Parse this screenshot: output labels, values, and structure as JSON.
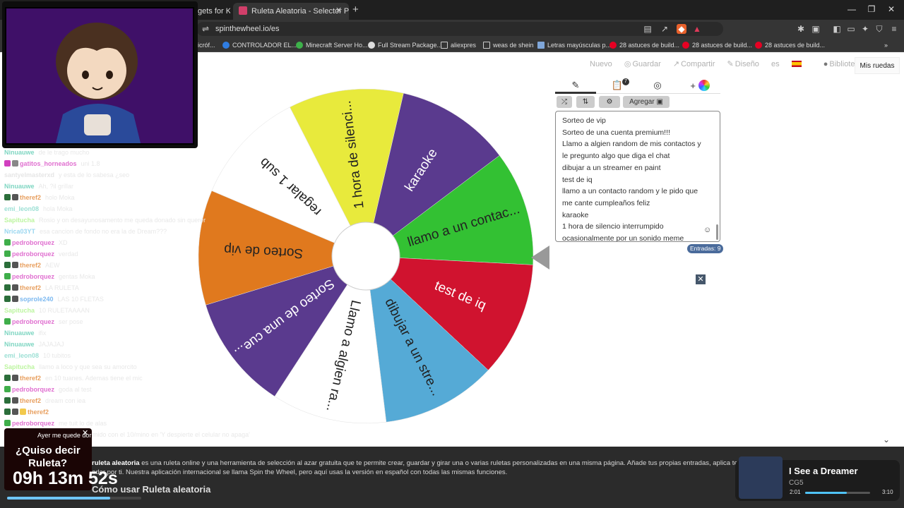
{
  "browser": {
    "tabs": [
      {
        "title": "gets for Ki"
      },
      {
        "title": "Ruleta Aleatoria - Selector Perso",
        "active": true
      }
    ],
    "url": "spinthewheel.io/es",
    "bookmarks": [
      "icróf...",
      "CONTROLADOR EL...",
      "Minecraft Server Ho...",
      "Full Stream Package...",
      "aliexpres",
      "weas de shein",
      "Letras mayúsculas p...",
      "28 astuces de build...",
      "28 astuces de build...",
      "28 astuces de build..."
    ]
  },
  "nav": {
    "nuevo": "Nuevo",
    "guardar": "Guardar",
    "compartir": "Compartir",
    "diseno": "Diseño",
    "lang": "es",
    "biblioteca": "Biblioteca",
    "mis_ruedas": "Mis ruedas"
  },
  "wheel": {
    "segments": [
      {
        "label": "karaoke",
        "color": "#5a3a8e",
        "text_color": "#ffffff"
      },
      {
        "label": "llamo a un contac...",
        "color": "#33c133",
        "text_color": "#222222"
      },
      {
        "label": "test de iq",
        "color": "#d0132f",
        "text_color": "#ffffff"
      },
      {
        "label": "dibujar a un stre...",
        "color": "#55aad6",
        "text_color": "#222222"
      },
      {
        "label": "Llamo a algien ra...",
        "color": "#ffffff",
        "text_color": "#222222"
      },
      {
        "label": "Sorteo de una cue...",
        "color": "#5a3a8e",
        "text_color": "#ffffff"
      },
      {
        "label": "Sorteo de vip",
        "color": "#e0791e",
        "text_color": "#222222"
      },
      {
        "label": "regalar 1 sub",
        "color": "#ffffff",
        "text_color": "#222222"
      },
      {
        "label": "1 hora de silenci...",
        "color": "#e8ea3c",
        "text_color": "#222222"
      }
    ],
    "pointer_color": "#999999"
  },
  "editor": {
    "badge": "7",
    "agregar": "Agregar",
    "entries": [
      "Sorteo de vip",
      "Sorteo de una cuenta premium!!!",
      "Llamo a algien random de mis contactos y",
      "le pregunto algo que diga el chat",
      "dibujar a un streamer en paint",
      "test de iq",
      "llamo a un contacto random y le pido que",
      "me cante cumpleaños feliz",
      "karaoke",
      "1 hora de silencio interrumpido",
      "ocasionalmente por un sonido meme"
    ],
    "entries_count": "Entradas: 9"
  },
  "chat": [
    {
      "user": "Ninuauwe",
      "color": "#7fd6c2",
      "msg": "de le trago mucho",
      "badges": []
    },
    {
      "user": "gatitos_horneados",
      "color": "#e070d0",
      "msg": "uni 1.8",
      "badges": [
        "#d13fbf",
        "#888888"
      ]
    },
    {
      "user": "santyelmasterxd",
      "color": "#e6e6e6",
      "msg": "y esta de lo sabesa ¿seo",
      "badges": []
    },
    {
      "user": "Ninuauwe",
      "color": "#7fd6c2",
      "msg": "Ah, ?il grillar",
      "badges": []
    },
    {
      "user": "theref2",
      "color": "#e8a060",
      "msg": "holo Moka",
      "badges": [
        "#2b6e3a",
        "#555555"
      ]
    },
    {
      "user": "emi_leon08",
      "color": "#9ee0d5",
      "msg": "hola Moka",
      "badges": []
    },
    {
      "user": "Sapitucha",
      "color": "#bdf5a0",
      "msg": "Rosio y on desayunosamento me queda donado sin querer",
      "badges": []
    },
    {
      "user": "Nrica03YT",
      "color": "#9bd7f0",
      "msg": "esa cancion de fondo no era la de Dream???",
      "badges": []
    },
    {
      "user": "pedroborquez",
      "color": "#e070d0",
      "msg": "XD",
      "badges": [
        "#3fae4a"
      ]
    },
    {
      "user": "pedroborquez",
      "color": "#e070d0",
      "msg": "verdad",
      "badges": [
        "#3fae4a"
      ]
    },
    {
      "user": "theref2",
      "color": "#e8a060",
      "msg": "AEW",
      "badges": [
        "#2b6e3a",
        "#555555"
      ]
    },
    {
      "user": "pedroborquez",
      "color": "#e070d0",
      "msg": "gentas Moka",
      "badges": [
        "#3fae4a"
      ]
    },
    {
      "user": "theref2",
      "color": "#e8a060",
      "msg": "LA RULETA",
      "badges": [
        "#2b6e3a",
        "#555555"
      ]
    },
    {
      "user": "soprole240",
      "color": "#7db9f0",
      "msg": "LAS 10 FLETAS",
      "badges": [
        "#2b6e3a",
        "#555555"
      ]
    },
    {
      "user": "Sapitucha",
      "color": "#bdf5a0",
      "msg": "10 RULETAAAAN",
      "badges": []
    },
    {
      "user": "pedroborquez",
      "color": "#e070d0",
      "msg": "ser pose",
      "badges": [
        "#3fae4a"
      ]
    },
    {
      "user": "Ninuauwe",
      "color": "#7fd6c2",
      "msg": "ifix",
      "badges": []
    },
    {
      "user": "Ninuauwe",
      "color": "#7fd6c2",
      "msg": "JAJAJAJ",
      "badges": []
    },
    {
      "user": "emi_leon08",
      "color": "#9ee0d5",
      "msg": "10 tubitos",
      "badges": []
    },
    {
      "user": "Sapitucha",
      "color": "#bdf5a0",
      "msg": "llamo a loco y que sea su amorcito",
      "badges": []
    },
    {
      "user": "theref2",
      "color": "#e8a060",
      "msg": "en 10 tuanes. Ademas tiene el mic",
      "badges": [
        "#2b6e3a",
        "#555555"
      ]
    },
    {
      "user": "pedroborquez",
      "color": "#e070d0",
      "msg": "goda al test",
      "badges": [
        "#3fae4a"
      ]
    },
    {
      "user": "theref2",
      "color": "#e8a060",
      "msg": "dream con iea",
      "badges": [
        "#2b6e3a",
        "#555555"
      ]
    },
    {
      "user": "theref2",
      "color": "#e8a060",
      "msg": "",
      "badges": [
        "#2b6e3a",
        "#555555",
        "#f2c94c"
      ]
    },
    {
      "user": "pedroborquez",
      "color": "#e070d0",
      "msg": "me tuit lo de alas",
      "badges": [
        "#3fae4a"
      ]
    },
    {
      "user": "Ninuauwe",
      "color": "#7fd6c2",
      "msg": "Ayer me quede dormido con el 10/mino en 'Y despierte el celular no apaga'",
      "badges": []
    }
  ],
  "description": {
    "lead": "ruleta aleatoria",
    "line1": "es una ruleta online y una herramienta de selección al azar gratuita que te permite crear, guardar y girar una o varias ruletas personalizadas en una misma página. Añade tus propias entradas, aplica temas y cambi",
    "line2": "ader por ti. Nuestra aplicación internacional se llama Spin the Wheel, pero aquí usas la versión en español con todas las mismas funciones.",
    "howto": "Cómo usar Ruleta aleatoria"
  },
  "alert": {
    "top": "Ayer me quede dor",
    "question1": "¿Quiso decir",
    "question2": "Ruleta?",
    "timer": "09h 13m 52s",
    "progress": 0.77
  },
  "music": {
    "song": "I See a Dreamer",
    "artist": "CG5",
    "elapsed": "2:01",
    "total": "3:10",
    "progress": 0.64
  }
}
